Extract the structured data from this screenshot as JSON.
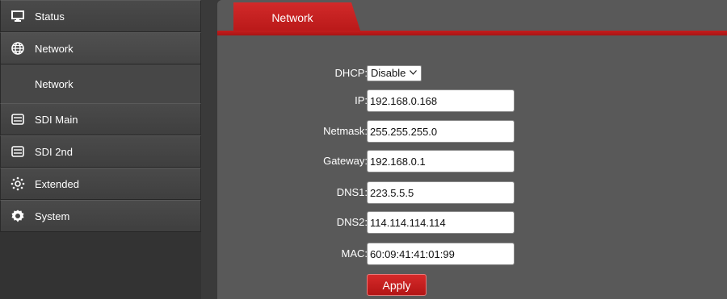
{
  "sidebar": {
    "items": [
      {
        "label": "Status",
        "icon": "monitor-icon"
      },
      {
        "label": "Network",
        "icon": "globe-icon"
      },
      {
        "label": "Network",
        "sub": true
      },
      {
        "label": "SDI Main",
        "icon": "drive-icon"
      },
      {
        "label": "SDI 2nd",
        "icon": "drive-icon"
      },
      {
        "label": "Extended",
        "icon": "gear-dots-icon"
      },
      {
        "label": "System",
        "icon": "settings-icon"
      }
    ]
  },
  "tab": {
    "label": "Network"
  },
  "form": {
    "dhcp": {
      "label": "DHCP:",
      "value": "Disable"
    },
    "ip": {
      "label": "IP:",
      "value": "192.168.0.168"
    },
    "netmask": {
      "label": "Netmask:",
      "value": "255.255.255.0"
    },
    "gateway": {
      "label": "Gateway:",
      "value": "192.168.0.1"
    },
    "dns1": {
      "label": "DNS1:",
      "value": "223.5.5.5"
    },
    "dns2": {
      "label": "DNS2:",
      "value": "114.114.114.114"
    },
    "mac": {
      "label": "MAC:",
      "value": "60:09:41:41:01:99"
    },
    "apply_label": "Apply"
  },
  "colors": {
    "accent": "#c41d1d",
    "sidebar_bg": "#333333",
    "panel_bg": "#595959"
  }
}
